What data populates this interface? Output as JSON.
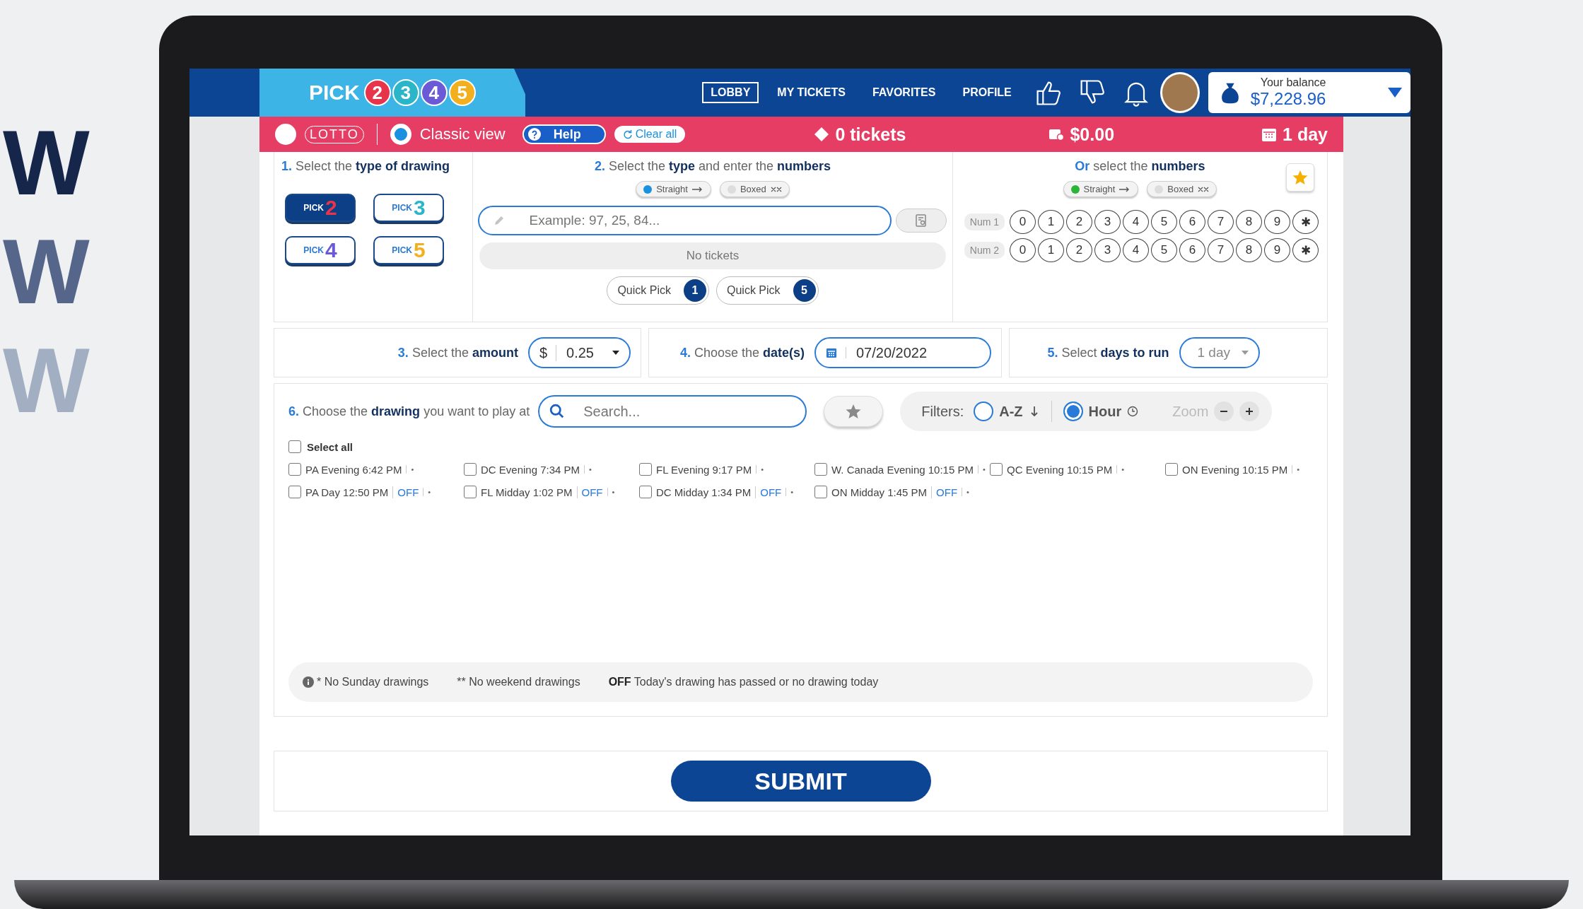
{
  "side_letters": [
    "W",
    "W",
    "W"
  ],
  "header": {
    "logo": {
      "word": "PICK",
      "digits": [
        {
          "digit": "2",
          "color": "#e8344a"
        },
        {
          "digit": "3",
          "color": "#2bb5c8"
        },
        {
          "digit": "4",
          "color": "#6a5ad8"
        },
        {
          "digit": "5",
          "color": "#f2b01e"
        }
      ]
    },
    "nav": [
      {
        "label": "LOBBY",
        "selected": true
      },
      {
        "label": "MY TICKETS",
        "selected": false
      },
      {
        "label": "FAVORITES",
        "selected": false
      },
      {
        "label": "PROFILE",
        "selected": false
      }
    ],
    "balance": {
      "label": "Your balance",
      "value": "$7,228.96"
    }
  },
  "toolbar": {
    "toggles": [
      {
        "label": "LOTTO",
        "on": false
      },
      {
        "label": "Classic view",
        "on": true
      }
    ],
    "help": "Help",
    "clear": "Clear all",
    "tickets": "0 tickets",
    "total": "$0.00",
    "days": "1 day"
  },
  "step1": {
    "number": "1.",
    "title": "Select the **type of drawing**",
    "games": [
      {
        "label": "PICK",
        "digit": "2",
        "color": "#e8344a",
        "selected": true
      },
      {
        "label": "PICK",
        "digit": "3",
        "color": "#2bb5c8",
        "selected": false
      },
      {
        "label": "PICK",
        "digit": "4",
        "color": "#6a5ad8",
        "selected": false
      },
      {
        "label": "PICK",
        "digit": "5",
        "color": "#f2b01e",
        "selected": false
      }
    ]
  },
  "step2": {
    "number": "2.",
    "title": "Select the **type** and enter the **numbers**",
    "modes": [
      {
        "label": "Straight",
        "selected": true
      },
      {
        "label": "Boxed",
        "selected": false
      }
    ],
    "placeholder": "Example: 97, 25, 84...",
    "tickets": "No tickets",
    "quick_picks": [
      {
        "label": "Quick Pick",
        "count": "1"
      },
      {
        "label": "Quick Pick",
        "count": "5"
      }
    ]
  },
  "step_or": {
    "prefix": "Or",
    "title": "select the **numbers**",
    "modes": [
      {
        "label": "Straight",
        "selected": true
      },
      {
        "label": "Boxed",
        "selected": false
      }
    ],
    "rows": [
      {
        "label": "Num 1",
        "keys": [
          "0",
          "1",
          "2",
          "3",
          "4",
          "5",
          "6",
          "7",
          "8",
          "9",
          "✱"
        ]
      },
      {
        "label": "Num 2",
        "keys": [
          "0",
          "1",
          "2",
          "3",
          "4",
          "5",
          "6",
          "7",
          "8",
          "9",
          "✱"
        ]
      }
    ]
  },
  "step3": {
    "number": "3.",
    "title": "Select the **amount**",
    "currency": "$",
    "amount": "0.25"
  },
  "step4": {
    "number": "4.",
    "title": "Choose the **date(s)**",
    "date": "07/20/2022"
  },
  "step5": {
    "number": "5.",
    "title": "Select **days to run**",
    "value": "1 day"
  },
  "step6": {
    "number": "6.",
    "title": "Choose the **drawing** you want to play at",
    "search_placeholder": "Search...",
    "filters_label": "Filters:",
    "filters": [
      {
        "label": "A-Z",
        "kind": "sort",
        "selected": false
      },
      {
        "label": "Hour",
        "kind": "clock",
        "selected": true
      }
    ],
    "zoom": "Zoom"
  },
  "drawings": {
    "select_all": {
      "label": "Select all",
      "checked": false
    },
    "rows": [
      [
        {
          "name": "PA Evening 6:42 PM",
          "checked": false
        },
        {
          "name": "DC Evening 7:34 PM",
          "checked": false
        },
        {
          "name": "FL Evening 9:17 PM",
          "checked": false
        },
        {
          "name": "W. Canada Evening 10:15 PM",
          "checked": false
        },
        {
          "name": "QC Evening 10:15 PM",
          "checked": false
        },
        {
          "name": "ON Evening 10:15 PM",
          "checked": false
        }
      ],
      [
        {
          "name": "PA Day 12:50 PM",
          "status": "OFF",
          "checked": false
        },
        {
          "name": "FL Midday 1:02 PM",
          "status": "OFF",
          "checked": false
        },
        {
          "name": "DC Midday 1:34 PM",
          "status": "OFF",
          "checked": false
        },
        {
          "name": "ON Midday 1:45 PM",
          "status": "OFF",
          "checked": false
        }
      ]
    ],
    "mark": "•"
  },
  "legend": [
    "* No Sunday drawings",
    "** No weekend drawings",
    "**OFF** Today's drawing has passed or no drawing today"
  ],
  "submit": "SUBMIT"
}
